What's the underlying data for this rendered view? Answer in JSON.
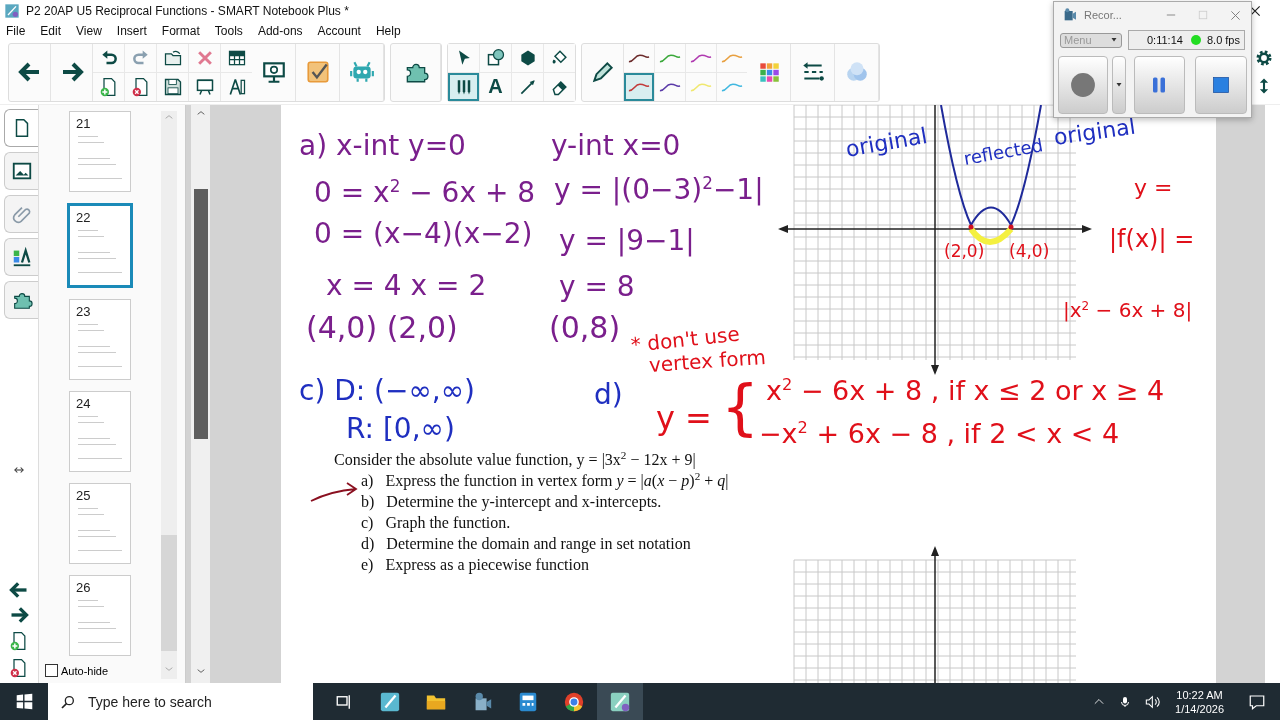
{
  "window": {
    "title": "P2 20AP U5 Reciprocal Functions - SMART Notebook Plus *"
  },
  "menu": [
    "File",
    "Edit",
    "View",
    "Insert",
    "Format",
    "Tools",
    "Add-ons",
    "Account",
    "Help"
  ],
  "toolbar": {
    "text_tool": "A",
    "pen_tool_selected": true,
    "pen_styles": [
      {
        "color": "#6b2a2a",
        "selected": false
      },
      {
        "color": "#c23a3a",
        "selected": true
      },
      {
        "color": "#3aa83a",
        "selected": false
      },
      {
        "color": "#5a3aa8",
        "selected": false
      },
      {
        "color": "#b03ab0",
        "selected": false
      },
      {
        "color": "#f0e870",
        "selected": false
      },
      {
        "color": "#e8a040",
        "selected": false
      },
      {
        "color": "#40b8e0",
        "selected": false
      }
    ]
  },
  "side_tabs": [
    {
      "kind": "page_sorter",
      "selected": true
    },
    {
      "kind": "gallery",
      "selected": false
    },
    {
      "kind": "attachments",
      "selected": false
    },
    {
      "kind": "properties",
      "selected": false
    },
    {
      "kind": "addons",
      "selected": false
    }
  ],
  "pages": [
    {
      "number": "21",
      "selected": false
    },
    {
      "number": "22",
      "selected": true
    },
    {
      "number": "23",
      "selected": false
    },
    {
      "number": "24",
      "selected": false
    },
    {
      "number": "25",
      "selected": false
    },
    {
      "number": "26",
      "selected": false
    }
  ],
  "auto_hide": {
    "label": "Auto-hide",
    "checked": false
  },
  "page": {
    "ink": [
      {
        "text": "a) x-int  y=0",
        "color": "#7a1f8c"
      },
      {
        "text": "0 = x$^{2}$ − 6x + 8",
        "color": "#7a1f8c"
      },
      {
        "text": "0 = (x−4)(x−2)",
        "color": "#7a1f8c"
      },
      {
        "text": "x = 4   x = 2",
        "color": "#7a1f8c"
      },
      {
        "text": "(4,0)  (2,0)",
        "color": "#7a1f8c"
      },
      {
        "text": "y-int  x=0",
        "color": "#7a1f8c"
      },
      {
        "text": "y = |(0−3)$^{2}$−1|",
        "color": "#7a1f8c"
      },
      {
        "text": "y = |9−1|",
        "color": "#7a1f8c"
      },
      {
        "text": "y = 8",
        "color": "#7a1f8c"
      },
      {
        "text": "(0,8)",
        "color": "#7a1f8c"
      },
      {
        "text": "c) D: (−∞,∞)",
        "color": "#1f2fc0"
      },
      {
        "text": "R: [0,∞)",
        "color": "#1f2fc0"
      },
      {
        "text": "d)",
        "color": "#1f2fc0"
      },
      {
        "text": "* don't use",
        "color": "#e0101a"
      },
      {
        "text": "vertex form",
        "color": "#e0101a"
      },
      {
        "text": "y =",
        "color": "#e0101a"
      },
      {
        "text": "{",
        "color": "#e0101a"
      },
      {
        "text": "x$^{2}$ − 6x + 8 , if  x ≤ 2  or x ≥ 4",
        "color": "#e0101a"
      },
      {
        "text": "−x$^{2}$ + 6x − 8 , if   2 < x < 4",
        "color": "#e0101a"
      },
      {
        "text": "original",
        "color": "#1f2fc0"
      },
      {
        "text": "reflected",
        "color": "#1f2fc0"
      },
      {
        "text": "original",
        "color": "#1f2fc0"
      },
      {
        "text": "(2,0)",
        "color": "#e0101a"
      },
      {
        "text": "(4,0)",
        "color": "#e0101a"
      },
      {
        "text": "y =",
        "color": "#e0101a"
      },
      {
        "text": "|f(x)| =",
        "color": "#e0101a"
      },
      {
        "text": "|x$^{2}$ − 6x + 8|",
        "color": "#e0101a"
      }
    ],
    "question": {
      "intro": "Consider the absolute value function, y = |3x$^{2}$ − 12x + 9|",
      "items": [
        {
          "letter": "a)",
          "text": "Express the function in vertex form *y* = |*a*(*x* − *p*)$^{2}$ + *q*|"
        },
        {
          "letter": "b)",
          "text": "Determine the y-intercept and x-intercepts."
        },
        {
          "letter": "c)",
          "text": "Graph the function."
        },
        {
          "letter": "d)",
          "text": "Determine the domain and range in set notation"
        },
        {
          "letter": "e)",
          "text": "Express as a piecewise function"
        }
      ]
    }
  },
  "recorder": {
    "title": "Recor...",
    "menu": "Menu",
    "time": "0:11:14",
    "fps": "8.0 fps"
  },
  "taskbar": {
    "search_placeholder": "Type here to search",
    "time": "10:22 AM",
    "date": "1/14/2026"
  }
}
